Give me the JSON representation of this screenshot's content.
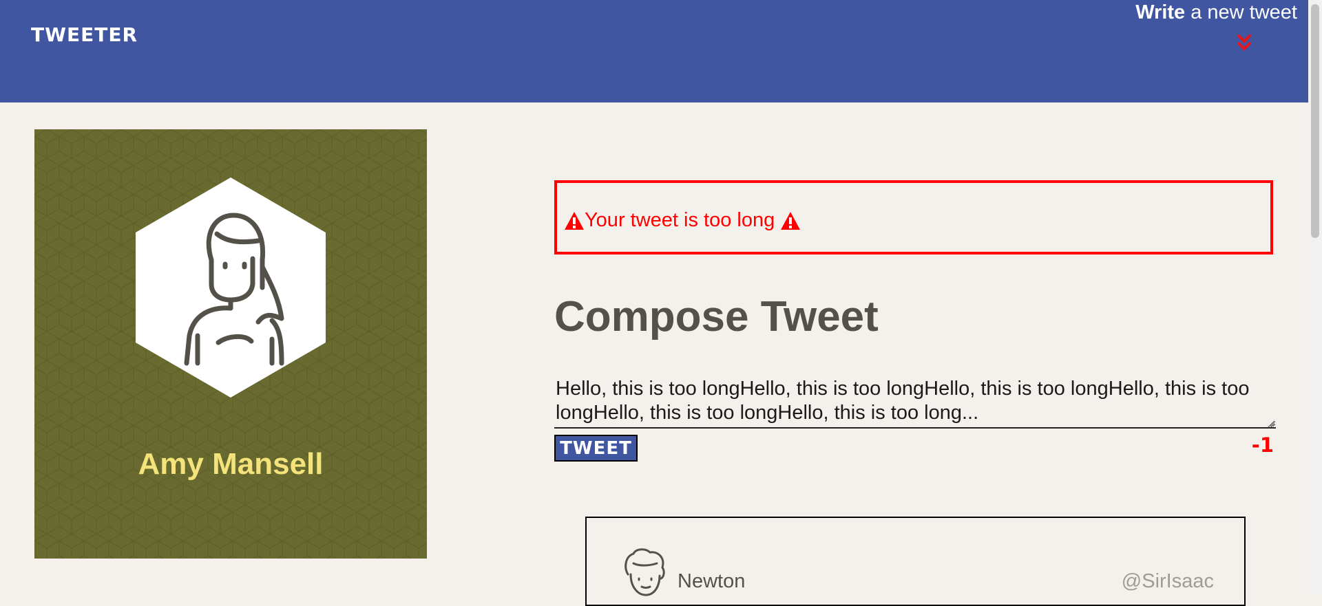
{
  "header": {
    "brand": "TWEETER",
    "write_bold": "Write",
    "write_rest": "a new tweet",
    "toggle_icon": "double-chevron-down-icon",
    "background": "#4056a1",
    "chevron_color": "#e8141c"
  },
  "profile": {
    "name": "Amy Mansell",
    "avatar_icon": "woman-avatar-icon",
    "background": "#686a30",
    "name_color": "#f3e37a"
  },
  "error": {
    "message": "Your tweet is too long",
    "icon": "warning-icon",
    "color": "#ff0000"
  },
  "compose": {
    "title": "Compose Tweet",
    "text": "Hello, this is too longHello, this is too longHello, this is too longHello, this is too longHello, this is too longHello, this is too long...",
    "button_label": "TWEET",
    "counter": "-1"
  },
  "tweets": [
    {
      "name": "Newton",
      "handle": "@SirIsaac",
      "avatar_icon": "curly-hair-avatar-icon"
    }
  ]
}
